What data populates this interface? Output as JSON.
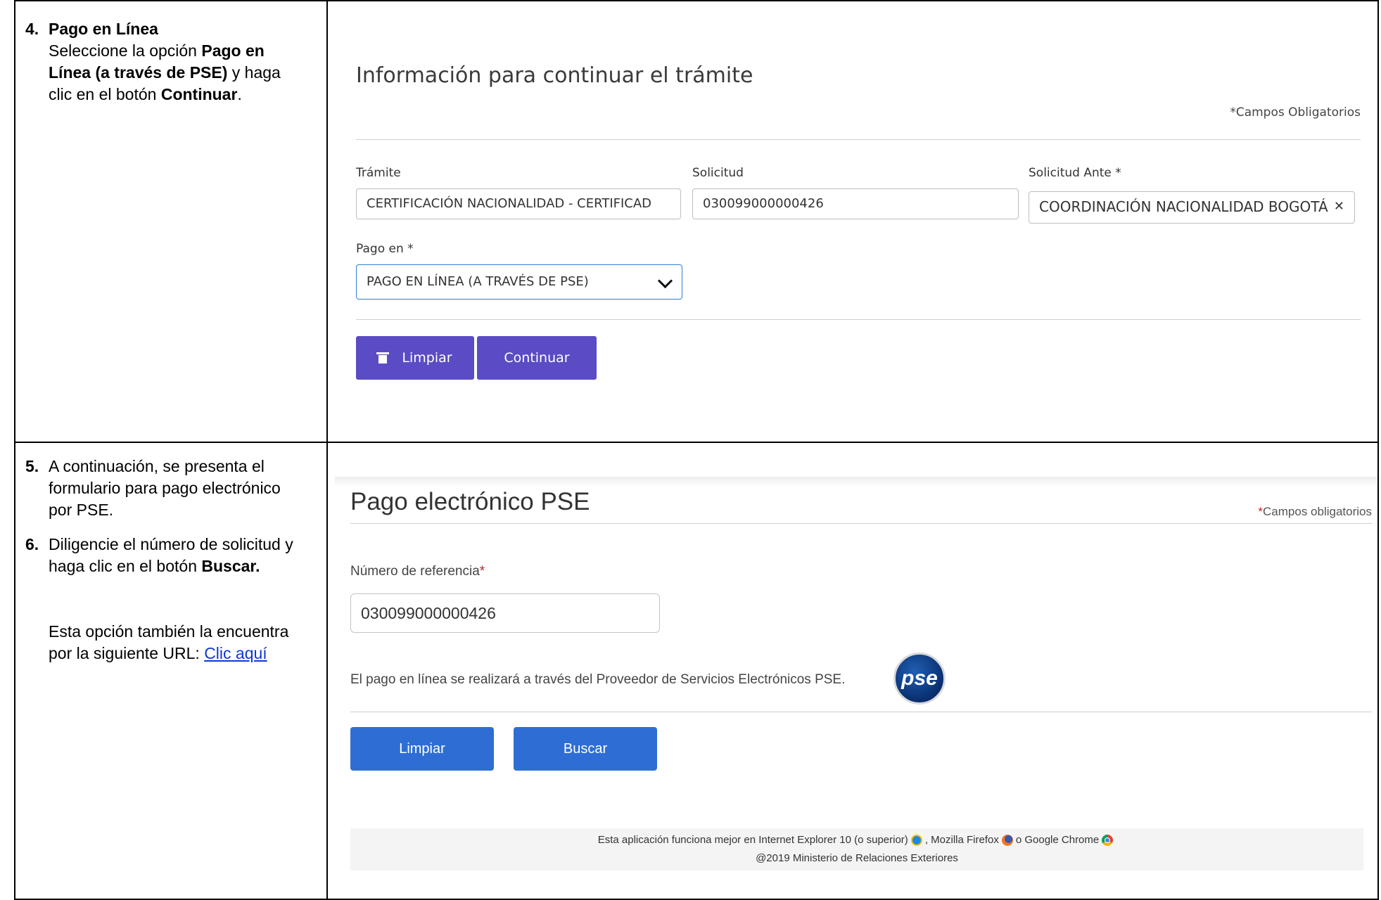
{
  "row1": {
    "step_num": "4.",
    "step_title": "Pago en Línea",
    "instr_a": "Seleccione la opción ",
    "instr_b": "Pago en Línea (a través de PSE)",
    "instr_c": " y haga clic en el botón ",
    "instr_d": "Continuar",
    "instr_e": "."
  },
  "panel1": {
    "title": "Información para continuar el trámite",
    "required_note": "*Campos Obligatorios",
    "fields": {
      "tramite_label": "Trámite",
      "tramite_value": "CERTIFICACIÓN NACIONALIDAD - CERTIFICAD",
      "solicitud_label": "Solicitud",
      "solicitud_value": "030099000000426",
      "solicitud_ante_label": "Solicitud Ante *",
      "solicitud_ante_value": "COORDINACIÓN NACIONALIDAD BOGOTÁ",
      "pago_label": "Pago en *",
      "pago_value": "PAGO EN LÍNEA (A TRAVÉS DE PSE)"
    },
    "buttons": {
      "clear": "Limpiar",
      "continue": "Continuar"
    },
    "accent": "#5b4bc4"
  },
  "row2": {
    "step5_num": "5.",
    "step5_text": "A continuación, se presenta el formulario para pago electrónico por PSE.",
    "step6_num": "6.",
    "step6_a": "Diligencie el número de solicitud y haga clic en el botón ",
    "step6_b": "Buscar.",
    "url_text": "Esta opción también la encuentra por la siguiente URL: ",
    "url_link": "Clic aquí"
  },
  "panel2": {
    "title": "Pago electrónico PSE",
    "required_star": "*",
    "required_note": "Campos obligatorios",
    "ref_label": "Número de referencia",
    "ref_star": "*",
    "ref_value": "030099000000426",
    "note": "El pago en línea se realizará a través del Proveedor de Servicios Electrónicos PSE.",
    "logo_text": "pse",
    "buttons": {
      "clear": "Limpiar",
      "search": "Buscar"
    },
    "footer_a": "Esta aplicación funciona mejor en Internet Explorer 10 (o superior)",
    "footer_b": ", Mozilla Firefox",
    "footer_c": "o Google Chrome",
    "footer_copy": "@2019 Ministerio de Relaciones Exteriores",
    "accent": "#2e6ed4"
  }
}
